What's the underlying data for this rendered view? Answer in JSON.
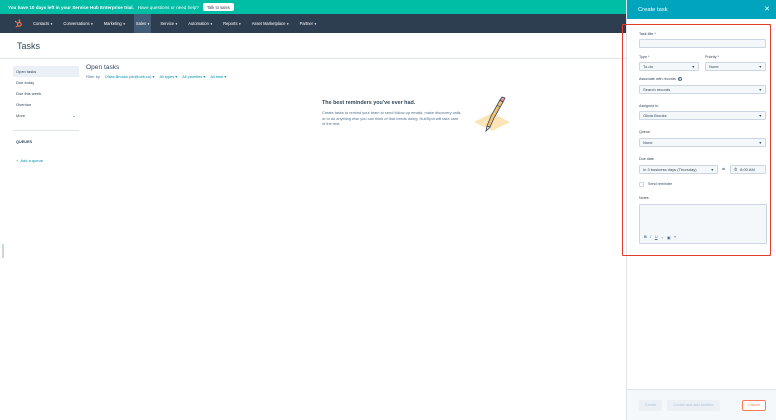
{
  "trial": {
    "message": "You have 10 days left in your Service Hub Enterprise trial.",
    "question": "Have questions or need help?",
    "button": "Talk to sales"
  },
  "nav": {
    "items": [
      "Contacts",
      "Conversations",
      "Marketing",
      "Sales",
      "Service",
      "Automation",
      "Reports",
      "Asset Marketplace",
      "Partner"
    ],
    "active": "Sales"
  },
  "page": {
    "title": "Tasks",
    "sidebar": {
      "items": [
        "Open tasks",
        "Due today",
        "Due this week",
        "Overdue",
        "More"
      ],
      "queues_heading": "QUEUES",
      "add_queue": "Add a queue"
    },
    "main": {
      "title": "Open tasks",
      "filter_label": "Filter by",
      "filters": [
        "Olivia Brooks (ob@obb.co)",
        "All types",
        "All priorities",
        "All time"
      ]
    },
    "empty_state": {
      "heading": "The best reminders you've ever had.",
      "body": "Create tasks to remind your team to send follow-up emails, make discovery calls, or to do anything else you can think of that needs doing. HubSpot will take care of the rest."
    }
  },
  "panel": {
    "title": "Create task",
    "task_title_label": "Task title *",
    "task_title_value": "",
    "type_label": "Type *",
    "type_value": "To-do",
    "priority_label": "Priority *",
    "priority_value": "None",
    "associate_label": "Associate with records",
    "associate_value": "Search records",
    "assigned_label": "Assigned to",
    "assigned_value": "Olivia Brooks",
    "queue_label": "Queue",
    "queue_value": "None",
    "due_label": "Due date",
    "due_value": "In 3 business days (Thursday)",
    "at_label": "at",
    "time_value": "8:00 AM",
    "reminder_label": "Send reminder",
    "notes_label": "Notes",
    "toolbar": [
      "B",
      "I",
      "U",
      "⌁",
      "▣",
      "≡"
    ],
    "buttons": {
      "create": "Create",
      "create_another": "Create and add another",
      "cancel": "Cancel"
    }
  },
  "colors": {
    "banner": "#00bda5",
    "nav": "#2d3e50",
    "panel_header": "#00a4bd",
    "highlight": "#e03e2d",
    "link": "#0091ae",
    "cancel": "#ff7a59"
  }
}
